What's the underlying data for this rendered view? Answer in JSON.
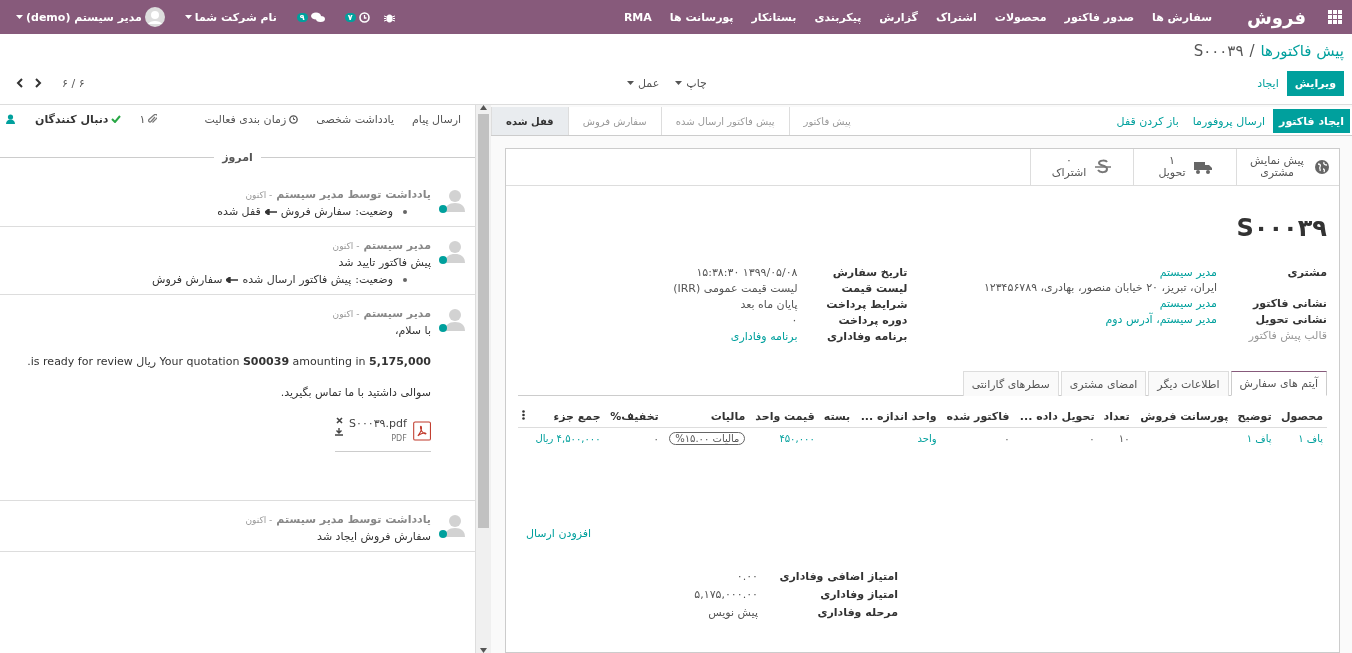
{
  "navbar": {
    "brand": "فروش",
    "menu": [
      "سفارش ها",
      "صدور فاکتور",
      "محصولات",
      "اشتراک",
      "گزارش",
      "پیکربندی",
      "بستانکار",
      "پورسانت ها",
      "RMA"
    ],
    "systray": {
      "activity_count": "۷",
      "message_count": "۹",
      "company": "نام شرکت شما",
      "user": "مدیر سیستم (demo)"
    }
  },
  "breadcrumb": {
    "parent": "پیش فاکتورها",
    "separator": "/",
    "current": "S۰۰۰۳۹"
  },
  "control": {
    "edit": "ویرایش",
    "create": "ایجاد",
    "print": "چاپ",
    "action": "عمل",
    "pager": "۶ / ۶"
  },
  "statusbar": {
    "buttons": [
      {
        "label": "ایجاد فاکتور",
        "primary": true
      },
      {
        "label": "ارسال پروفورما",
        "primary": false
      },
      {
        "label": "باز کردن قفل",
        "primary": false
      }
    ],
    "stages": [
      {
        "label": "پیش فاکتور",
        "selected": false
      },
      {
        "label": "پیش فاکتور ارسال شده",
        "selected": false
      },
      {
        "label": "سفارش فروش",
        "selected": false
      },
      {
        "label": "قفل شده",
        "selected": true
      }
    ]
  },
  "smart_buttons": [
    {
      "kind": "globe",
      "label": "پیش نمایش مشتری"
    },
    {
      "kind": "truck",
      "value": "۱",
      "label": "تحویل"
    },
    {
      "kind": "subscription",
      "value": "۰",
      "label": "اشتراک"
    }
  ],
  "title": "S۰۰۰۳۹",
  "customer_group": [
    {
      "label": "مشتری",
      "value": "مدیر سیستم",
      "link": true,
      "extra": "ایران، تبریز، ۲۰ خیابان منصور، بهادری، ۱۲۳۴۵۶۷۸۹"
    },
    {
      "label": "نشانی فاکتور",
      "value": "مدیر سیستم",
      "link": true
    },
    {
      "label": "نشانی تحویل",
      "value": "مدیر سیستم، آدرس دوم",
      "link": true
    },
    {
      "label": "قالب پیش فاکتور",
      "muted": true
    }
  ],
  "order_group": [
    {
      "label": "تاریخ سفارش",
      "value": "۱۳۹۹/۰۵/۰۸ ۱۵:۳۸:۳۰",
      "link": false
    },
    {
      "label": "لیست قیمت",
      "value": "لیست قیمت عمومی (IRR)",
      "link": false
    },
    {
      "label": "شرایط پرداخت",
      "value": "پایان ماه بعد",
      "link": false
    },
    {
      "label": "دوره پرداخت",
      "value": "۰",
      "link": false
    },
    {
      "label": "برنامه وفاداری",
      "value": "برنامه وفاداری",
      "link": true
    }
  ],
  "tabs": [
    {
      "label": "آیتم های سفارش",
      "selected": true
    },
    {
      "label": "اطلاعات دیگر",
      "selected": false
    },
    {
      "label": "امضای مشتری",
      "selected": false
    },
    {
      "label": "سطرهای گارانتی",
      "selected": false
    }
  ],
  "table": {
    "columns": [
      "محصول",
      "توضیح",
      "پورسانت فروش",
      "تعداد",
      "تحویل داده ...",
      "فاکتور شده",
      "واحد اندازه ...",
      "بسته",
      "قیمت واحد",
      "مالیات",
      "تخفیف%",
      "جمع جزء"
    ],
    "rows": [
      {
        "product": "پاف ۱",
        "description": "پاف ۱",
        "commission": "",
        "quantity": "۱۰",
        "delivered": "۰",
        "invoiced": "۰",
        "uom": "واحد",
        "package": "",
        "price": "۴۵۰,۰۰۰",
        "tax": "مالیات ۱۵.۰۰%",
        "discount": "۰",
        "subtotal": "۴,۵۰۰,۰۰۰ ریال"
      }
    ],
    "add_line": "افزودن ارسال"
  },
  "loyalty": [
    {
      "label": "امتیاز اضافی وفاداری",
      "value": "۰.۰۰"
    },
    {
      "label": "امتیاز وفاداری",
      "value": "۵,۱۷۵,۰۰۰.۰۰"
    },
    {
      "label": "مرحله وفاداری",
      "value": "پیش نویس"
    }
  ],
  "chatter": {
    "send_message": "ارسال پیام",
    "log_note": "یادداشت شخصی",
    "schedule": "زمان بندی فعالیت",
    "attachments": "۱",
    "follow": "دنبال کنندگان",
    "date_divider": "امروز",
    "messages": [
      {
        "author": "یادداشت توسط مدیر سیستم",
        "date": "- اکنون",
        "tracking": [
          {
            "field": "وضعیت:",
            "old": "سفارش فروش",
            "new": "قفل شده"
          }
        ]
      },
      {
        "author": "مدیر سیستم",
        "date": "- اکنون",
        "body": [
          "پیش فاکتور تایید شد"
        ],
        "tracking": [
          {
            "field": "وضعیت:",
            "old": "پیش فاکتور ارسال شده",
            "new": "سفارش فروش"
          }
        ]
      },
      {
        "author": "مدیر سیستم",
        "date": "- اکنون",
        "email": [
          "با سلام،",
          "Your quotation **S00039** amounting in **5,175,000** ریال is ready for review.",
          "سوالی داشتید با ما تماس بگیرید."
        ],
        "attachment": {
          "name": "S۰۰۰۳۹.pdf",
          "type": "PDF"
        }
      },
      {
        "author": "یادداشت توسط مدیر سیستم",
        "date": "- اکنون",
        "body": [
          "سفارش فروش ایجاد شد"
        ]
      }
    ]
  }
}
